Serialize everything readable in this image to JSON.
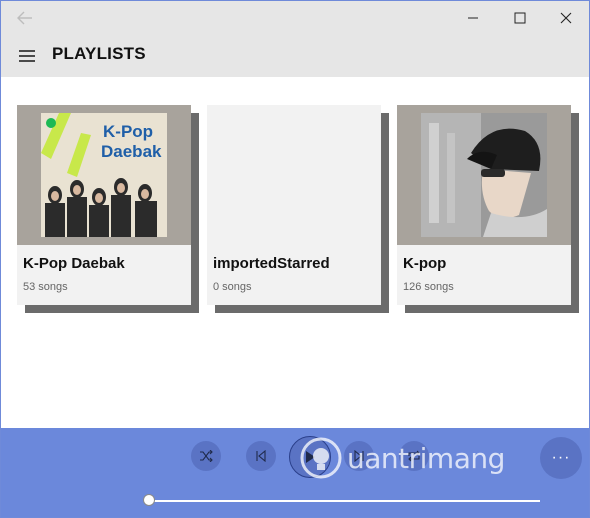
{
  "window": {
    "page_title": "PLAYLISTS",
    "icons": {
      "back": "arrow-left-icon",
      "menu": "hamburger-icon",
      "minimize": "minimize-icon",
      "maximize": "maximize-icon",
      "close": "close-icon"
    }
  },
  "playlists": [
    {
      "name": "K-Pop Daebak",
      "count": "53 songs",
      "art_text_1": "K-Pop",
      "art_text_2": "Daebak",
      "art_accent": "#c8e84a",
      "art_text_color": "#1f5fa8"
    },
    {
      "name": "importedStarred",
      "count": "0 songs"
    },
    {
      "name": "K-pop",
      "count": "126 songs"
    }
  ],
  "player": {
    "background": "#6b88db",
    "controls": [
      "shuffle-icon",
      "previous-icon",
      "play-icon",
      "next-icon",
      "repeat-icon"
    ],
    "more_label": "···",
    "progress": 0.0,
    "watermark_text": "uantrimang"
  }
}
